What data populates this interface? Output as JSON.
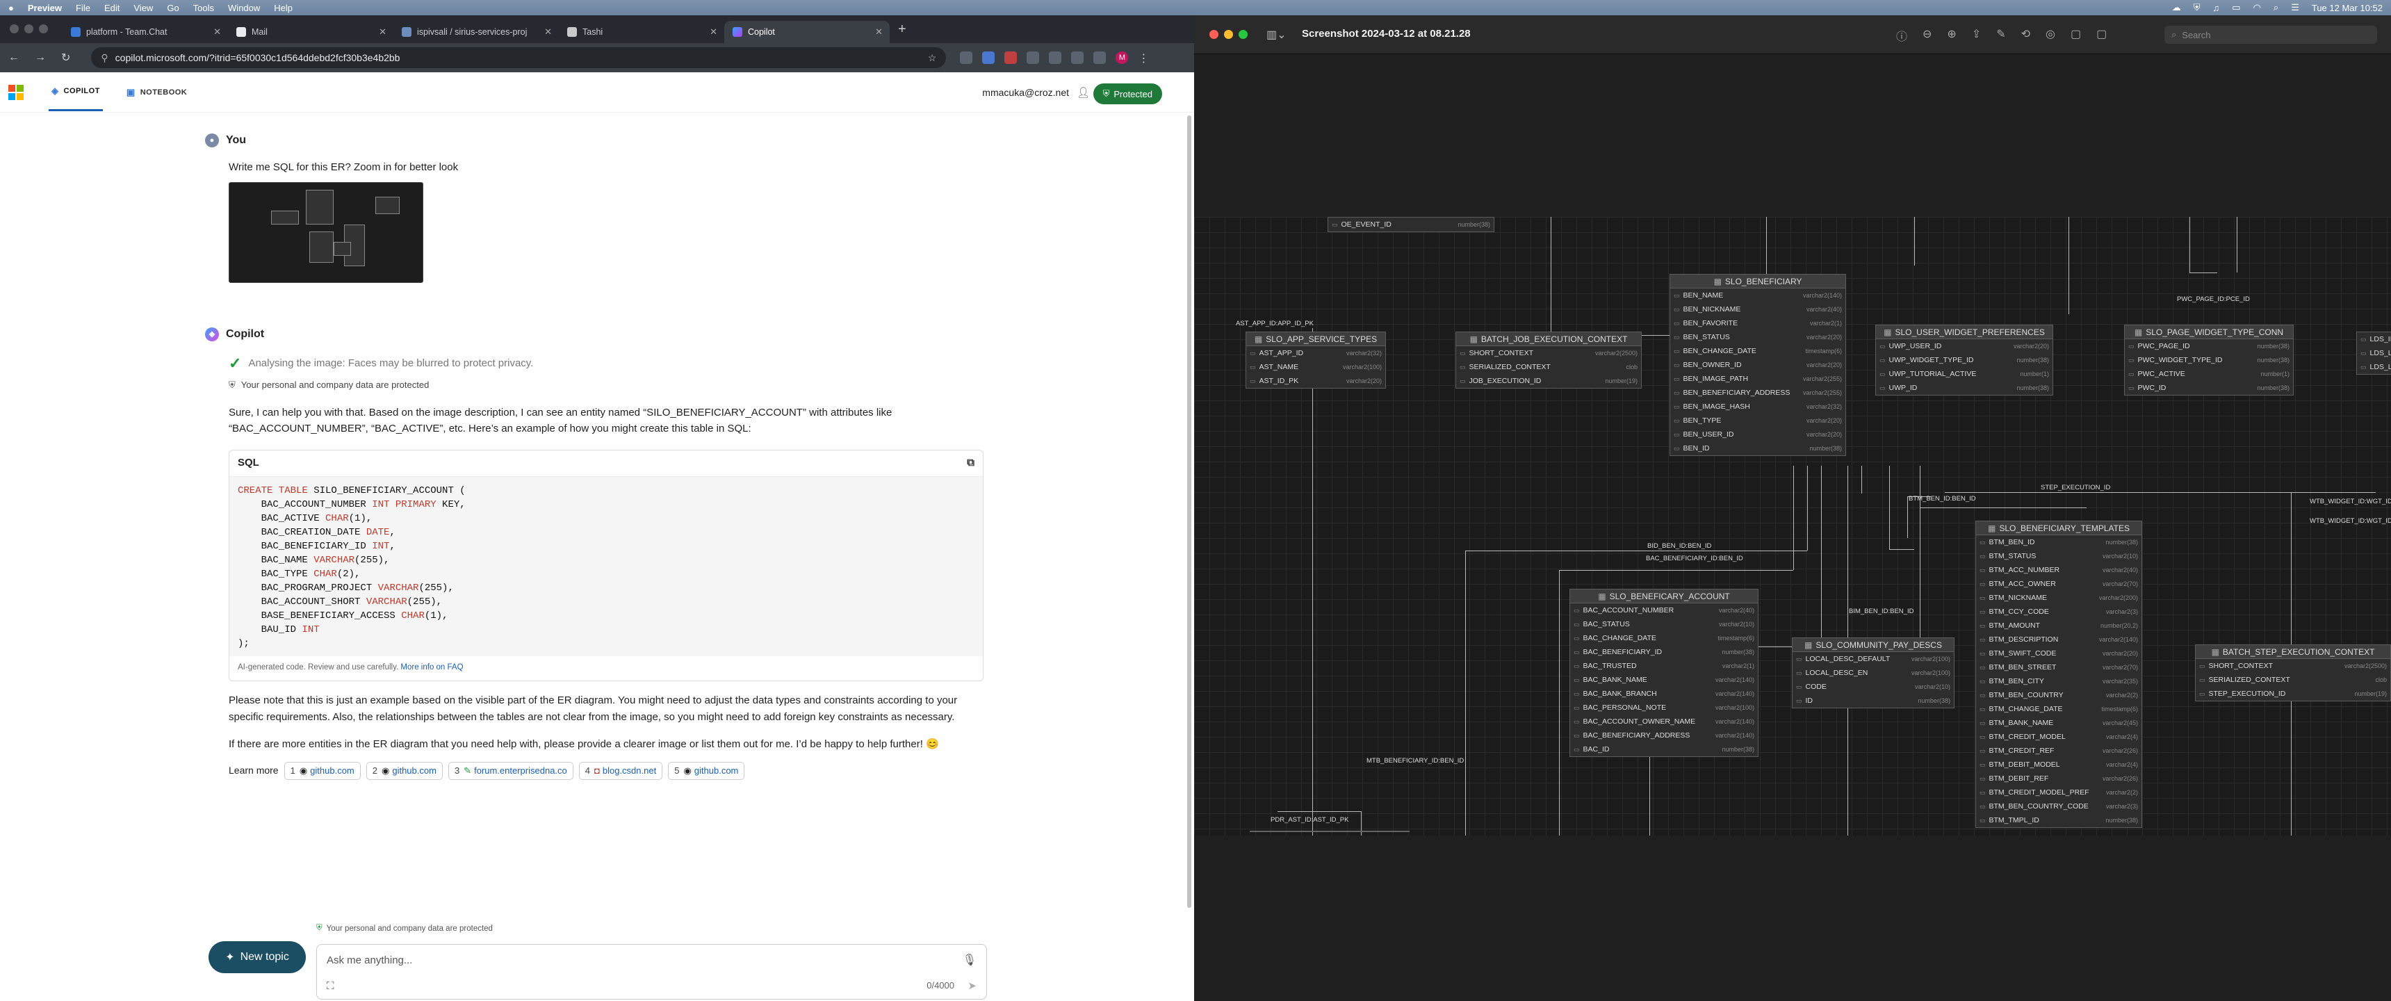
{
  "menubar": {
    "app": "Preview",
    "items": [
      "File",
      "Edit",
      "View",
      "Go",
      "Tools",
      "Window",
      "Help"
    ],
    "clock": "Tue 12 Mar 10:52"
  },
  "browser": {
    "tabs": [
      {
        "title": "platform - Team.Chat"
      },
      {
        "title": "Mail"
      },
      {
        "title": "ispivsali / sirius-services-proj"
      },
      {
        "title": "Tashi"
      },
      {
        "title": "Copilot"
      }
    ],
    "url": "copilot.microsoft.com/?itrid=65f0030c1d564ddebd2fcf30b3e4b2bb",
    "profile_initial": "M"
  },
  "copilot": {
    "tab_copilot": "COPILOT",
    "tab_notebook": "NOTEBOOK",
    "user_email": "mmacuka@croz.net",
    "protected_label": "Protected",
    "you_label": "You",
    "user_message": "Write me SQL for this ER? Zoom in for better look",
    "copilot_label": "Copilot",
    "analysing": "Analysing the image: Faces may be blurred to protect privacy.",
    "privacy_note": "Your personal and company data are protected",
    "intro": "Sure, I can help you with that. Based on the image description, I can see an entity named “SILO_BENEFICIARY_ACCOUNT” with attributes like “BAC_ACCOUNT_NUMBER”, “BAC_ACTIVE”, etc. Here’s an example of how you might create this table in SQL:",
    "code_lang": "SQL",
    "code_lines": [
      {
        "t": "CREATE TABLE",
        "r": " SILO_BENEFICIARY_ACCOUNT ("
      },
      {
        "p": "    BAC_ACCOUNT_NUMBER ",
        "t": "INT PRIMARY",
        "r": " KEY,"
      },
      {
        "p": "    BAC_ACTIVE ",
        "t": "CHAR",
        "r": "(1),"
      },
      {
        "p": "    BAC_CREATION_DATE ",
        "t": "DATE",
        "r": ","
      },
      {
        "p": "    BAC_BENEFICIARY_ID ",
        "t": "INT",
        "r": ","
      },
      {
        "p": "    BAC_NAME ",
        "t": "VARCHAR",
        "r": "(255),"
      },
      {
        "p": "    BAC_TYPE ",
        "t": "CHAR",
        "r": "(2),"
      },
      {
        "p": "    BAC_PROGRAM_PROJECT ",
        "t": "VARCHAR",
        "r": "(255),"
      },
      {
        "p": "    BAC_ACCOUNT_SHORT ",
        "t": "VARCHAR",
        "r": "(255),"
      },
      {
        "p": "    BASE_BENEFICIARY_ACCESS ",
        "t": "CHAR",
        "r": "(1),"
      },
      {
        "p": "    BAU_ID ",
        "t": "INT"
      },
      {
        "p": ");"
      }
    ],
    "code_footer": "AI-generated code. Review and use carefully.",
    "code_footer_link": "More info on FAQ",
    "para1": "Please note that this is just an example based on the visible part of the ER diagram. You might need to adjust the data types and constraints according to your specific requirements. Also, the relationships between the tables are not clear from the image, so you might need to add foreign key constraints as necessary.",
    "para2": "If there are more entities in the ER diagram that you need help with, please provide a clearer image or list them out for me. I’d be happy to help further! 😊",
    "learn_more": "Learn more",
    "sources": [
      {
        "n": "1",
        "label": "github.com"
      },
      {
        "n": "2",
        "label": "github.com"
      },
      {
        "n": "3",
        "label": "forum.enterprisedna.co"
      },
      {
        "n": "4",
        "label": "blog.csdn.net"
      },
      {
        "n": "5",
        "label": "github.com"
      }
    ],
    "bottom_note": "Your personal and company data are protected",
    "new_topic": "New topic",
    "ask_placeholder": "Ask me anything...",
    "char_count": "0/4000"
  },
  "preview": {
    "title": "Screenshot 2024-03-12 at 08.21.28",
    "search_placeholder": "Search"
  },
  "er": {
    "entities": [
      {
        "name": "",
        "cols": [
          {
            "k": "OE_EVENT_ID",
            "t": "number(38)"
          }
        ]
      },
      {
        "name": "SLO_APP_SERVICE_TYPES",
        "cols": [
          {
            "k": "AST_APP_ID",
            "t": "varchar2(32)"
          },
          {
            "k": "AST_NAME",
            "t": "varchar2(100)"
          },
          {
            "k": "AST_ID_PK",
            "t": "varchar2(20)"
          }
        ]
      },
      {
        "name": "BATCH_JOB_EXECUTION_CONTEXT",
        "cols": [
          {
            "k": "SHORT_CONTEXT",
            "t": "varchar2(2500)"
          },
          {
            "k": "SERIALIZED_CONTEXT",
            "t": "clob"
          },
          {
            "k": "JOB_EXECUTION_ID",
            "t": "number(19)"
          }
        ]
      },
      {
        "name": "SLO_BENEFICIARY",
        "cols": [
          {
            "k": "BEN_NAME",
            "t": "varchar2(140)"
          },
          {
            "k": "BEN_NICKNAME",
            "t": "varchar2(40)"
          },
          {
            "k": "BEN_FAVORITE",
            "t": "varchar2(1)"
          },
          {
            "k": "BEN_STATUS",
            "t": "varchar2(20)"
          },
          {
            "k": "BEN_CHANGE_DATE",
            "t": "timestamp(6)"
          },
          {
            "k": "BEN_OWNER_ID",
            "t": "varchar2(20)"
          },
          {
            "k": "BEN_IMAGE_PATH",
            "t": "varchar2(255)"
          },
          {
            "k": "BEN_BENEFICIARY_ADDRESS",
            "t": "varchar2(255)"
          },
          {
            "k": "BEN_IMAGE_HASH",
            "t": "varchar2(32)"
          },
          {
            "k": "BEN_TYPE",
            "t": "varchar2(20)"
          },
          {
            "k": "BEN_USER_ID",
            "t": "varchar2(20)"
          },
          {
            "k": "BEN_ID",
            "t": "number(38)"
          }
        ]
      },
      {
        "name": "SLO_USER_WIDGET_PREFERENCES",
        "cols": [
          {
            "k": "UWP_USER_ID",
            "t": "varchar2(20)"
          },
          {
            "k": "UWP_WIDGET_TYPE_ID",
            "t": "number(38)"
          },
          {
            "k": "UWP_TUTORIAL_ACTIVE",
            "t": "number(1)"
          },
          {
            "k": "UWP_ID",
            "t": "number(38)"
          }
        ]
      },
      {
        "name": "SLO_PAGE_WIDGET_TYPE_CONN",
        "cols": [
          {
            "k": "PWC_PAGE_ID",
            "t": "number(38)"
          },
          {
            "k": "PWC_WIDGET_TYPE_ID",
            "t": "number(38)"
          },
          {
            "k": "PWC_ACTIVE",
            "t": "number(1)"
          },
          {
            "k": "PWC_ID",
            "t": "number(38)"
          }
        ]
      },
      {
        "name": "SLO_BENEFICIARY_TEMPLATES",
        "cols": [
          {
            "k": "BTM_BEN_ID",
            "t": "number(38)"
          },
          {
            "k": "BTM_STATUS",
            "t": "varchar2(10)"
          },
          {
            "k": "BTM_ACC_NUMBER",
            "t": "varchar2(40)"
          },
          {
            "k": "BTM_ACC_OWNER",
            "t": "varchar2(70)"
          },
          {
            "k": "BTM_NICKNAME",
            "t": "varchar2(200)"
          },
          {
            "k": "BTM_CCY_CODE",
            "t": "varchar2(3)"
          },
          {
            "k": "BTM_AMOUNT",
            "t": "number(20,2)"
          },
          {
            "k": "BTM_DESCRIPTION",
            "t": "varchar2(140)"
          },
          {
            "k": "BTM_SWIFT_CODE",
            "t": "varchar2(20)"
          },
          {
            "k": "BTM_BEN_STREET",
            "t": "varchar2(70)"
          },
          {
            "k": "BTM_BEN_CITY",
            "t": "varchar2(35)"
          },
          {
            "k": "BTM_BEN_COUNTRY",
            "t": "varchar2(2)"
          },
          {
            "k": "BTM_CHANGE_DATE",
            "t": "timestamp(6)"
          },
          {
            "k": "BTM_BANK_NAME",
            "t": "varchar2(45)"
          },
          {
            "k": "BTM_CREDIT_MODEL",
            "t": "varchar2(4)"
          },
          {
            "k": "BTM_CREDIT_REF",
            "t": "varchar2(26)"
          },
          {
            "k": "BTM_DEBIT_MODEL",
            "t": "varchar2(4)"
          },
          {
            "k": "BTM_DEBIT_REF",
            "t": "varchar2(26)"
          },
          {
            "k": "BTM_CREDIT_MODEL_PREF",
            "t": "varchar2(2)"
          },
          {
            "k": "BTM_BEN_COUNTRY_CODE",
            "t": "varchar2(3)"
          },
          {
            "k": "BTM_TMPL_ID",
            "t": "number(38)"
          }
        ]
      },
      {
        "name": "SLO_BENEFICARY_ACCOUNT",
        "cols": [
          {
            "k": "BAC_ACCOUNT_NUMBER",
            "t": "varchar2(40)"
          },
          {
            "k": "BAC_STATUS",
            "t": "varchar2(10)"
          },
          {
            "k": "BAC_CHANGE_DATE",
            "t": "timestamp(6)"
          },
          {
            "k": "BAC_BENEFICIARY_ID",
            "t": "number(38)"
          },
          {
            "k": "BAC_TRUSTED",
            "t": "varchar2(1)"
          },
          {
            "k": "BAC_BANK_NAME",
            "t": "varchar2(140)"
          },
          {
            "k": "BAC_BANK_BRANCH",
            "t": "varchar2(140)"
          },
          {
            "k": "BAC_PERSONAL_NOTE",
            "t": "varchar2(100)"
          },
          {
            "k": "BAC_ACCOUNT_OWNER_NAME",
            "t": "varchar2(140)"
          },
          {
            "k": "BAC_BENEFICIARY_ADDRESS",
            "t": "varchar2(140)"
          },
          {
            "k": "BAC_ID",
            "t": "number(38)"
          }
        ]
      },
      {
        "name": "SLO_COMMUNITY_PAY_DESCS",
        "cols": [
          {
            "k": "LOCAL_DESC_DEFAULT",
            "t": "varchar2(100)"
          },
          {
            "k": "LOCAL_DESC_EN",
            "t": "varchar2(100)"
          },
          {
            "k": "CODE",
            "t": "varchar2(10)"
          },
          {
            "k": "ID",
            "t": "number(38)"
          }
        ]
      },
      {
        "name": "BATCH_STEP_EXECUTION_CONTEXT",
        "cols": [
          {
            "k": "SHORT_CONTEXT",
            "t": "varchar2(2500)"
          },
          {
            "k": "SERIALIZED_CONTEXT",
            "t": "clob"
          },
          {
            "k": "STEP_EXECUTION_ID",
            "t": "number(19)"
          }
        ]
      },
      {
        "name": "",
        "cols": [
          {
            "k": "LDS_ID",
            "t": ""
          },
          {
            "k": "LDS_LA",
            "t": ""
          },
          {
            "k": "LDS_LO",
            "t": ""
          }
        ]
      }
    ],
    "labels": [
      "AST_APP_ID:APP_ID_PK",
      "PWC_PAGE_ID:PCE_ID",
      "BTM_BEN_ID:BEN_ID",
      "STEP_EXECUTION_ID",
      "BID_BEN_ID:BEN_ID",
      "BAC_BENEFICIARY_ID:BEN_ID",
      "BIM_BEN_ID:BEN_ID",
      "MTB_BENEFICIARY_ID:BEN_ID",
      "PDR_AST_ID:AST_ID_PK",
      "WTB_WIDGET_ID:WGT_ID",
      "WTB_WIDGET_ID:WGT_ID"
    ]
  }
}
